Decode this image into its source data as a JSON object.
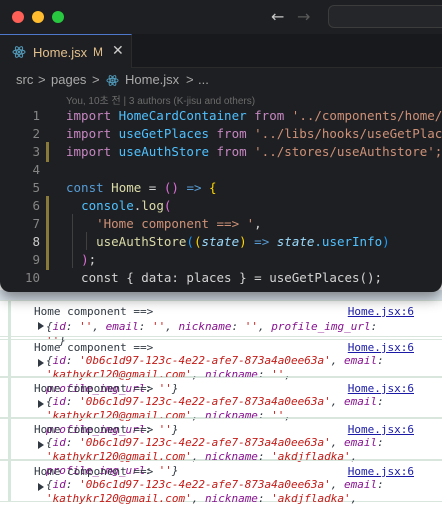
{
  "window": {
    "nav": {
      "back": "←",
      "forward": "→"
    }
  },
  "tab": {
    "name": "Home.jsx",
    "modified": "M",
    "close": "✕"
  },
  "breadcrumb": {
    "part1": "src",
    "sep1": ">",
    "part2": "pages",
    "sep2": ">",
    "part3": "Home.jsx",
    "sep3": ">",
    "part4": "..."
  },
  "blame": "You, 10초 전 | 3 authors (K-jisu and others)",
  "code": {
    "line_numbers": [
      "1",
      "2",
      "3",
      "4",
      "5",
      "6",
      "7",
      "8",
      "9",
      "10"
    ],
    "l1": {
      "kw1": "import",
      "id": " HomeCardContainer ",
      "kw2": "from",
      "str": " '../components/home/HomeCardContainer';"
    },
    "l2": {
      "kw1": "import",
      "id": " useGetPlaces ",
      "kw2": "from",
      "str": " '../libs/hooks/useGetPlaces';"
    },
    "l3": {
      "kw1": "import",
      "id": " useAuthStore ",
      "kw2": "from",
      "str": " '../stores/useAuthstore';"
    },
    "l5": {
      "kw": "const",
      "fn": " Home",
      "rest": " = ",
      "br1": "(",
      "br2": ")",
      "arrow": " => ",
      "br3": "{"
    },
    "l6": {
      "obj": "console",
      "dot": ".",
      "fn": "log",
      "br": "("
    },
    "l7": {
      "str": "'Home component ==> '",
      "comma": ","
    },
    "l8": {
      "fn": "useAuthStore",
      "br1": "(",
      "br2": "(",
      "par": "state",
      "br3": ")",
      "arrow": " => ",
      "var": "state",
      "prop": ".userInfo",
      "br4": ")"
    },
    "l9": {
      "br": ")",
      "semi": ";"
    },
    "l10": {
      "text": "  const { data: places } = useGetPlaces();"
    }
  },
  "console": {
    "logs": [
      {
        "label": "Home component ==>",
        "source": "Home.jsx:6",
        "id": "''",
        "email": "''",
        "nickname": "''",
        "profile_img_url": "''"
      },
      {
        "label": "Home component ==>",
        "source": "Home.jsx:6",
        "id": "'0b6c1d97-123c-4e22-afe7-873a4a0ee63a'",
        "email": "'kathykr120@gmail.com'",
        "nickname": "''",
        "profile_img_url": "''"
      },
      {
        "label": "Home component ==>",
        "source": "Home.jsx:6",
        "id": "'0b6c1d97-123c-4e22-afe7-873a4a0ee63a'",
        "email": "'kathykr120@gmail.com'",
        "nickname": "''",
        "profile_img_url": "''"
      },
      {
        "label": "Home component ==>",
        "source": "Home.jsx:6",
        "id": "'0b6c1d97-123c-4e22-afe7-873a4a0ee63a'",
        "email": "'kathykr120@gmail.com'",
        "nickname": "'akdjfladka'",
        "profile_img_url": "''"
      },
      {
        "label": "Home component ==>",
        "source": "Home.jsx:6",
        "id": "'0b6c1d97-123c-4e22-afe7-873a4a0ee63a'",
        "email": "'kathykr120@gmail.com'",
        "nickname": "'akdjfladka'",
        "profile_img_url": "''"
      }
    ]
  }
}
